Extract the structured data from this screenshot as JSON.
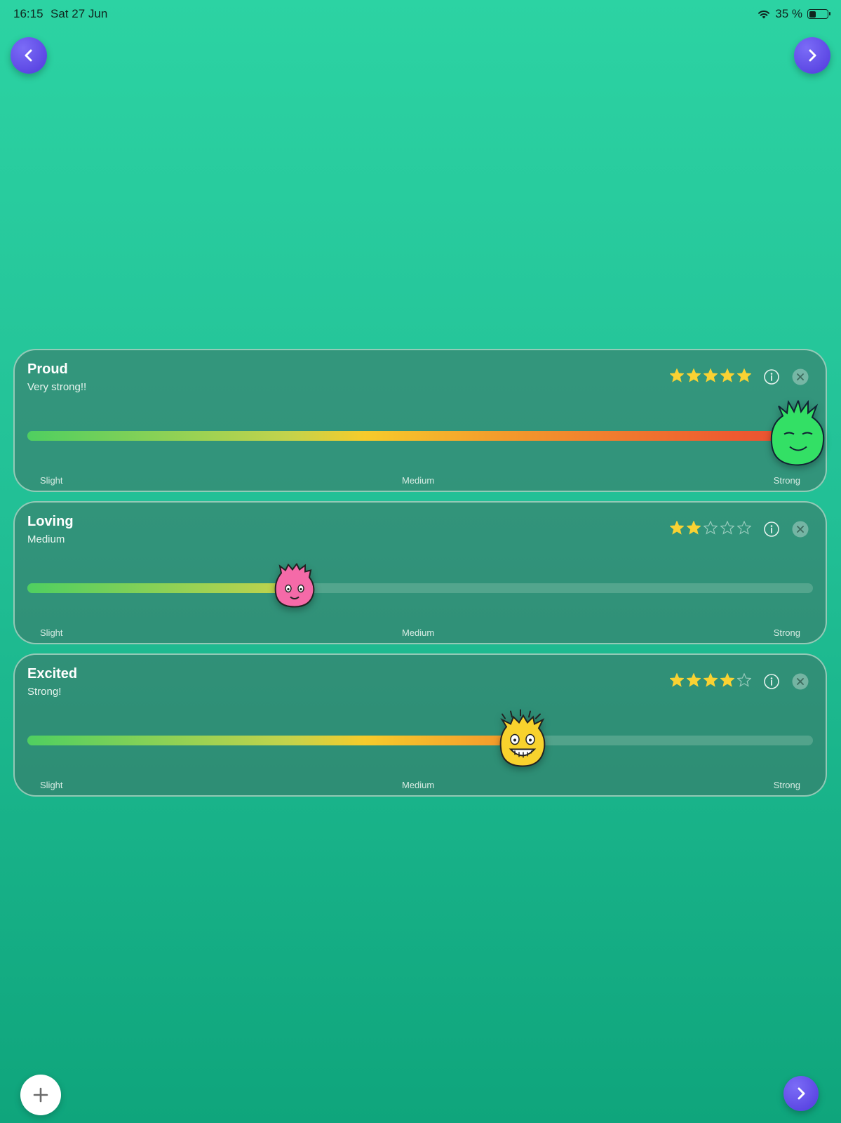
{
  "status_bar": {
    "time": "16:15",
    "date": "Sat 27 Jun",
    "battery": "35 %",
    "battery_level": 0.35
  },
  "nav": {
    "back_icon": "chevron-left-icon",
    "forward_icon": "chevron-right-icon"
  },
  "scale_labels": {
    "slight": "Slight",
    "medium": "Medium",
    "strong": "Strong"
  },
  "colors": {
    "star_filled": "#f9d233",
    "accent": "#5b45e6",
    "background": "#22c096"
  },
  "cards": [
    {
      "title": "Proud",
      "subtitle": "Very strong!!",
      "rating": 5,
      "max_rating": 5,
      "intensity": 1.0,
      "face": "green-face",
      "face_color": "#33e065"
    },
    {
      "title": "Loving",
      "subtitle": "Medium",
      "rating": 2,
      "max_rating": 5,
      "intensity": 0.34,
      "face": "pink-face",
      "face_color": "#f56aa8"
    },
    {
      "title": "Excited",
      "subtitle": "Strong!",
      "rating": 4,
      "max_rating": 5,
      "intensity": 0.63,
      "face": "yellow-face",
      "face_color": "#f8d22d"
    }
  ],
  "bottom": {
    "add_icon": "plus-icon",
    "next_icon": "chevron-right-icon"
  }
}
